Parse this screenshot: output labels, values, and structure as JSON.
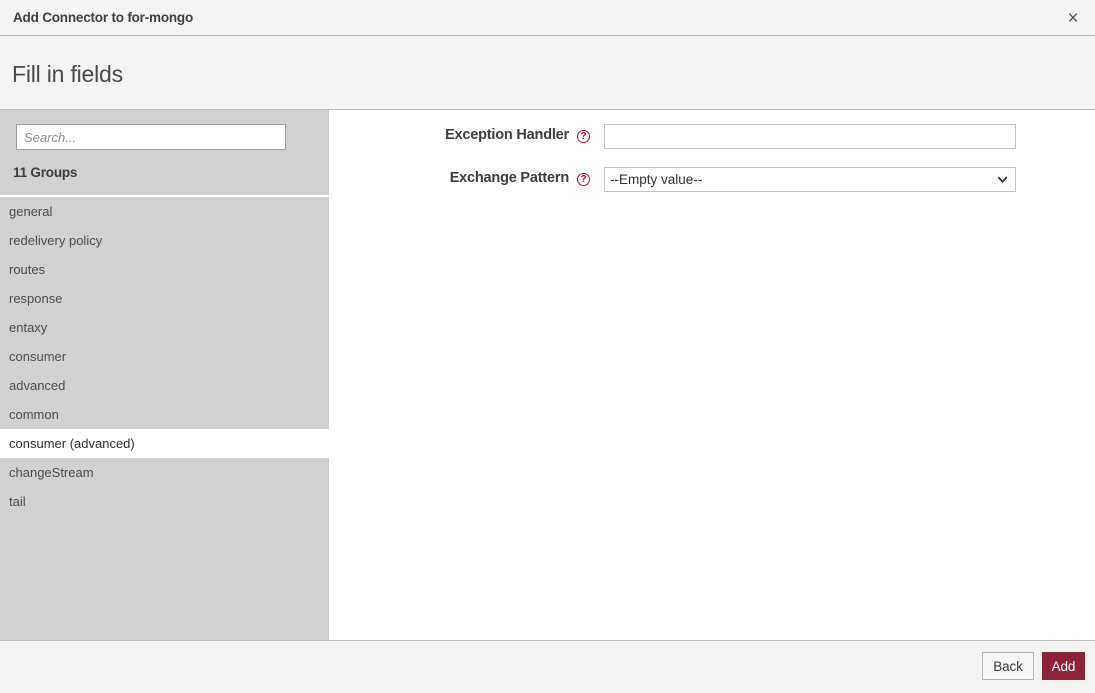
{
  "window": {
    "title": "Add Connector to for-mongo",
    "close_icon": "close-icon",
    "close_glyph": "×"
  },
  "header": {
    "heading": "Fill in fields"
  },
  "sidebar": {
    "search": {
      "placeholder": "Search...",
      "value": ""
    },
    "groups_count_label": "11 Groups",
    "items": [
      {
        "label": "general",
        "selected": false
      },
      {
        "label": "redelivery policy",
        "selected": false
      },
      {
        "label": "routes",
        "selected": false
      },
      {
        "label": "response",
        "selected": false
      },
      {
        "label": "entaxy",
        "selected": false
      },
      {
        "label": "consumer",
        "selected": false
      },
      {
        "label": "advanced",
        "selected": false
      },
      {
        "label": "common",
        "selected": false
      },
      {
        "label": "consumer (advanced)",
        "selected": true
      },
      {
        "label": "changeStream",
        "selected": false
      },
      {
        "label": "tail",
        "selected": false
      }
    ]
  },
  "form": {
    "fields": [
      {
        "label": "Exception Handler",
        "type": "text",
        "value": "",
        "placeholder": "",
        "help_icon": "help-icon",
        "help_glyph": "?"
      },
      {
        "label": "Exchange Pattern",
        "type": "select",
        "value": "--Empty value--",
        "options": [
          "--Empty value--"
        ],
        "help_icon": "help-icon",
        "help_glyph": "?"
      }
    ]
  },
  "footer": {
    "back_label": "Back",
    "add_label": "Add"
  },
  "colors": {
    "accent_red": "#8e2239",
    "help_red": "#cc0033",
    "sidebar_gray": "#d1d1d1",
    "header_gray": "#f4f4f4"
  }
}
